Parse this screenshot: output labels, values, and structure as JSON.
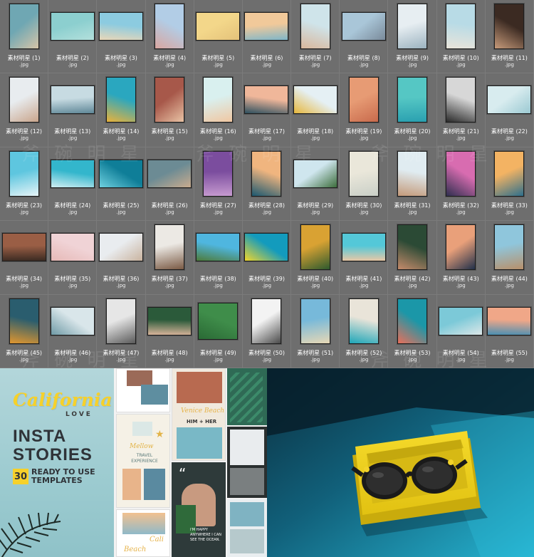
{
  "grid": {
    "items": [
      {
        "name": "素材明星 (1)",
        "ext": ".jpg",
        "shape": "portrait",
        "colors": [
          "#6fa7b3",
          "#d6c4a8"
        ]
      },
      {
        "name": "素材明星 (2)",
        "ext": ".jpg",
        "shape": "land",
        "colors": [
          "#8ccfcf",
          "#b3e0dc"
        ]
      },
      {
        "name": "素材明星 (3)",
        "ext": ".jpg",
        "shape": "land",
        "colors": [
          "#8ccbe0",
          "#e9d7b8"
        ]
      },
      {
        "name": "素材明星 (4)",
        "ext": ".jpg",
        "shape": "portrait",
        "colors": [
          "#b2cde6",
          "#d9a6a0"
        ]
      },
      {
        "name": "素材明星 (5)",
        "ext": ".jpg",
        "shape": "land",
        "colors": [
          "#f3d78a",
          "#e4c27a"
        ]
      },
      {
        "name": "素材明星 (6)",
        "ext": ".jpg",
        "shape": "land",
        "colors": [
          "#f1c99a",
          "#7fb6c9"
        ]
      },
      {
        "name": "素材明星 (7)",
        "ext": ".jpg",
        "shape": "portrait",
        "colors": [
          "#cfe4ea",
          "#d8b79c"
        ]
      },
      {
        "name": "素材明星 (8)",
        "ext": ".jpg",
        "shape": "land",
        "colors": [
          "#a9c6d8",
          "#7a8a9a"
        ]
      },
      {
        "name": "素材明星 (9)",
        "ext": ".jpg",
        "shape": "portrait",
        "colors": [
          "#e7eef2",
          "#9cb3c0"
        ]
      },
      {
        "name": "素材明星 (10)",
        "ext": ".jpg",
        "shape": "portrait",
        "colors": [
          "#b8dbe6",
          "#e9e4da"
        ]
      },
      {
        "name": "素材明星 (11)",
        "ext": ".jpg",
        "shape": "portrait",
        "colors": [
          "#3b2a22",
          "#c69a7a"
        ]
      },
      {
        "name": "素材明星 (12)",
        "ext": ".jpg",
        "shape": "portrait",
        "colors": [
          "#e8ecef",
          "#c9a58c"
        ]
      },
      {
        "name": "素材明星 (13)",
        "ext": ".jpg",
        "shape": "land",
        "colors": [
          "#c7dbe2",
          "#5f8797"
        ]
      },
      {
        "name": "素材明星 (14)",
        "ext": ".jpg",
        "shape": "portrait",
        "colors": [
          "#2aa7bf",
          "#e9b23b"
        ]
      },
      {
        "name": "素材明星 (15)",
        "ext": ".jpg",
        "shape": "portrait",
        "colors": [
          "#a7584a",
          "#e9c3a5"
        ]
      },
      {
        "name": "素材明星 (16)",
        "ext": ".jpg",
        "shape": "portrait",
        "colors": [
          "#d9f0ef",
          "#f0c7a2"
        ]
      },
      {
        "name": "素材明星 (17)",
        "ext": ".jpg",
        "shape": "land",
        "colors": [
          "#f0b79a",
          "#2d4f5e"
        ]
      },
      {
        "name": "素材明星 (18)",
        "ext": ".jpg",
        "shape": "land",
        "colors": [
          "#e5f0f4",
          "#e6b73c"
        ]
      },
      {
        "name": "素材明星 (19)",
        "ext": ".jpg",
        "shape": "portrait",
        "colors": [
          "#e79b74",
          "#c86a4c"
        ]
      },
      {
        "name": "素材明星 (20)",
        "ext": ".jpg",
        "shape": "portrait",
        "colors": [
          "#55c7c4",
          "#2aa0b0"
        ]
      },
      {
        "name": "素材明星 (21)",
        "ext": ".jpg",
        "shape": "portrait",
        "colors": [
          "#d7d7d7",
          "#2a2a2a"
        ]
      },
      {
        "name": "素材明星 (22)",
        "ext": ".jpg",
        "shape": "land",
        "colors": [
          "#d8ecef",
          "#9bc9d2"
        ]
      },
      {
        "name": "素材明星 (23)",
        "ext": ".jpg",
        "shape": "portrait",
        "colors": [
          "#5ec6df",
          "#e7f4f7"
        ]
      },
      {
        "name": "素材明星 (24)",
        "ext": ".jpg",
        "shape": "land",
        "colors": [
          "#33b6cc",
          "#d0eef2"
        ]
      },
      {
        "name": "素材明星 (25)",
        "ext": ".jpg",
        "shape": "land",
        "colors": [
          "#0f7e98",
          "#6fd0df"
        ]
      },
      {
        "name": "素材明星 (26)",
        "ext": ".jpg",
        "shape": "land",
        "colors": [
          "#6c8b94",
          "#c9ab8e"
        ]
      },
      {
        "name": "素材明星 (27)",
        "ext": ".jpg",
        "shape": "portrait",
        "colors": [
          "#7b4d9e",
          "#c79bd0"
        ]
      },
      {
        "name": "素材明星 (28)",
        "ext": ".jpg",
        "shape": "portrait",
        "colors": [
          "#f0b57f",
          "#1c5870"
        ]
      },
      {
        "name": "素材明星 (29)",
        "ext": ".jpg",
        "shape": "land",
        "colors": [
          "#cfe6ee",
          "#3d6e3c"
        ]
      },
      {
        "name": "素材明星 (30)",
        "ext": ".jpg",
        "shape": "portrait",
        "colors": [
          "#eae7da",
          "#c9cfc7"
        ]
      },
      {
        "name": "素材明星 (31)",
        "ext": ".jpg",
        "shape": "portrait",
        "colors": [
          "#e0ecf1",
          "#c49a7a"
        ]
      },
      {
        "name": "素材明星 (32)",
        "ext": ".jpg",
        "shape": "portrait",
        "colors": [
          "#d86cb0",
          "#2f2f4f"
        ]
      },
      {
        "name": "素材明星 (33)",
        "ext": ".jpg",
        "shape": "portrait",
        "colors": [
          "#f3b363",
          "#2e6f8c"
        ]
      },
      {
        "name": "素材明星 (34)",
        "ext": ".jpg",
        "shape": "land",
        "colors": [
          "#9a5e45",
          "#3a2a22"
        ]
      },
      {
        "name": "素材明星 (35)",
        "ext": ".jpg",
        "shape": "land",
        "colors": [
          "#f0d3d6",
          "#e6b9b7"
        ]
      },
      {
        "name": "素材明星 (36)",
        "ext": ".jpg",
        "shape": "land",
        "colors": [
          "#e9ecef",
          "#c9b39f"
        ]
      },
      {
        "name": "素材明星 (37)",
        "ext": ".jpg",
        "shape": "portrait",
        "colors": [
          "#ece9e4",
          "#7a5a44"
        ]
      },
      {
        "name": "素材明星 (38)",
        "ext": ".jpg",
        "shape": "land",
        "colors": [
          "#4fb6df",
          "#4d7a3a"
        ]
      },
      {
        "name": "素材明星 (39)",
        "ext": ".jpg",
        "shape": "land",
        "colors": [
          "#139bbd",
          "#f2d62b"
        ]
      },
      {
        "name": "素材明星 (40)",
        "ext": ".jpg",
        "shape": "portrait",
        "colors": [
          "#d9a233",
          "#2e5a2e"
        ]
      },
      {
        "name": "素材明星 (41)",
        "ext": ".jpg",
        "shape": "land",
        "colors": [
          "#54c8d8",
          "#e8c8a6"
        ]
      },
      {
        "name": "素材明星 (42)",
        "ext": ".jpg",
        "shape": "portrait",
        "colors": [
          "#2b4a35",
          "#c58b6b"
        ]
      },
      {
        "name": "素材明星 (43)",
        "ext": ".jpg",
        "shape": "portrait",
        "colors": [
          "#e9a07a",
          "#20304a"
        ]
      },
      {
        "name": "素材明星 (44)",
        "ext": ".jpg",
        "shape": "portrait",
        "colors": [
          "#8fc6dc",
          "#b8906a"
        ]
      },
      {
        "name": "素材明星 (45)",
        "ext": ".jpg",
        "shape": "portrait",
        "colors": [
          "#2a5d6e",
          "#e0962f"
        ]
      },
      {
        "name": "素材明星 (46)",
        "ext": ".jpg",
        "shape": "land",
        "colors": [
          "#d9e6ea",
          "#6f9aa6"
        ]
      },
      {
        "name": "素材明星 (47)",
        "ext": ".jpg",
        "shape": "portrait",
        "colors": [
          "#e6e6e6",
          "#5a5a5a"
        ]
      },
      {
        "name": "素材明星 (48)",
        "ext": ".jpg",
        "shape": "land",
        "colors": [
          "#2b5a3a",
          "#d8b49a"
        ]
      },
      {
        "name": "素材明星 (49)",
        "ext": ".jpg",
        "shape": "square",
        "colors": [
          "#3f8d4a",
          "#2a6a35"
        ]
      },
      {
        "name": "素材明星 (50)",
        "ext": ".jpg",
        "shape": "portrait",
        "colors": [
          "#f3f3f3",
          "#4a4a4a"
        ]
      },
      {
        "name": "素材明星 (51)",
        "ext": ".jpg",
        "shape": "portrait",
        "colors": [
          "#77b9da",
          "#e7d7b5"
        ]
      },
      {
        "name": "素材明星 (52)",
        "ext": ".jpg",
        "shape": "portrait",
        "colors": [
          "#e9e4d9",
          "#1ea6b8"
        ]
      },
      {
        "name": "素材明星 (53)",
        "ext": ".jpg",
        "shape": "portrait",
        "colors": [
          "#1b97a8",
          "#e96f5a"
        ]
      },
      {
        "name": "素材明星 (54)",
        "ext": ".jpg",
        "shape": "land",
        "colors": [
          "#7cc9d8",
          "#dde7e8"
        ]
      },
      {
        "name": "素材明星 (55)",
        "ext": ".jpg",
        "shape": "land",
        "colors": [
          "#f0a788",
          "#4a8fb2"
        ]
      }
    ]
  },
  "watermark": {
    "text": "斧 碗 明 星"
  },
  "cover": {
    "script_title": "California",
    "love": "LOVE",
    "line1": "INSTA",
    "line2": "STORIES",
    "count": "30",
    "ready_line1": "READY TO USE",
    "ready_line2": "TEMPLATES"
  },
  "templates": {
    "travel_title": "Mellow",
    "travel_sub": "TRAVEL EXPERIENCE",
    "venice": "Venice Beach",
    "him_her": "HIM + HER",
    "quote_mark": "“",
    "quote_text": "I'M HAPPY ANYWHERE I CAN SEE THE OCEAN.",
    "cali": "Cali",
    "beach": "Beach"
  },
  "colors": {
    "accent_yellow": "#f6d12a",
    "ocean_blue": "#1a9fbf"
  }
}
